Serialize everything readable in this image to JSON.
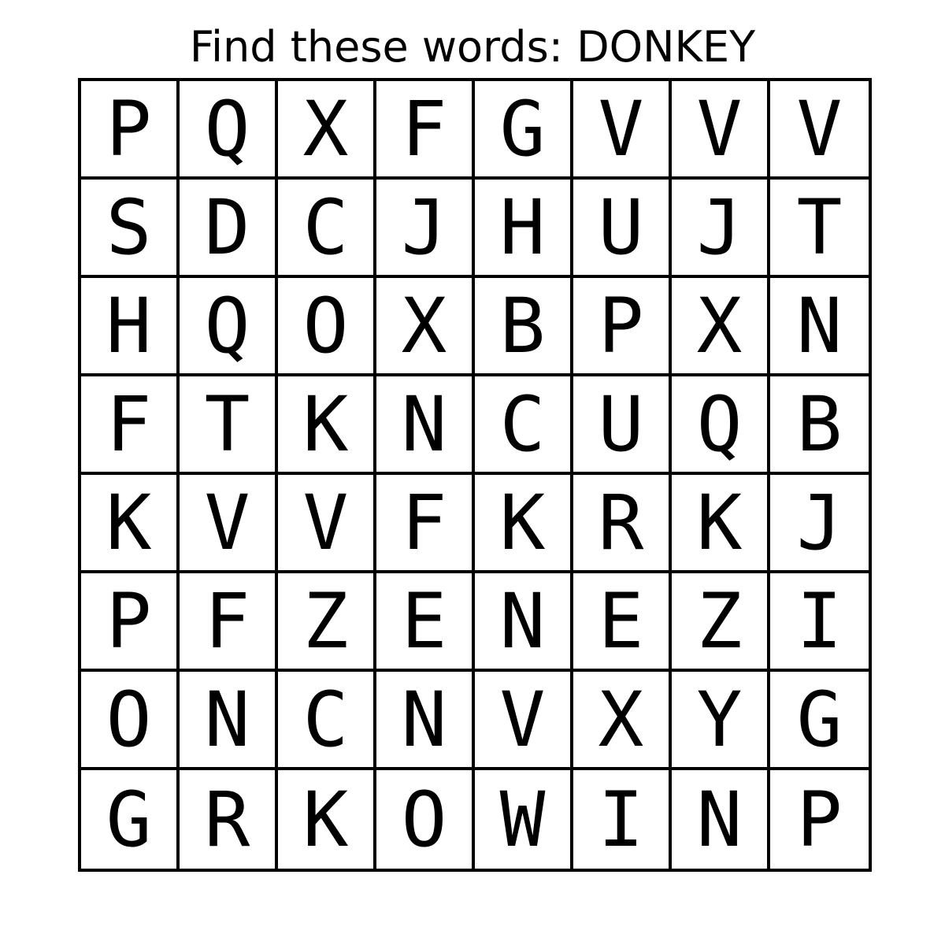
{
  "puzzle": {
    "title": "Find these words: DONKEY",
    "grid": [
      [
        "P",
        "Q",
        "X",
        "F",
        "G",
        "V",
        "V",
        "V"
      ],
      [
        "S",
        "D",
        "C",
        "J",
        "H",
        "U",
        "J",
        "T"
      ],
      [
        "H",
        "Q",
        "O",
        "X",
        "B",
        "P",
        "X",
        "N"
      ],
      [
        "F",
        "T",
        "K",
        "N",
        "C",
        "U",
        "Q",
        "B"
      ],
      [
        "K",
        "V",
        "V",
        "F",
        "K",
        "R",
        "K",
        "J"
      ],
      [
        "P",
        "F",
        "Z",
        "E",
        "N",
        "E",
        "Z",
        "I"
      ],
      [
        "O",
        "N",
        "C",
        "N",
        "V",
        "X",
        "Y",
        "G"
      ],
      [
        "G",
        "R",
        "K",
        "O",
        "W",
        "I",
        "N",
        "P"
      ]
    ]
  }
}
